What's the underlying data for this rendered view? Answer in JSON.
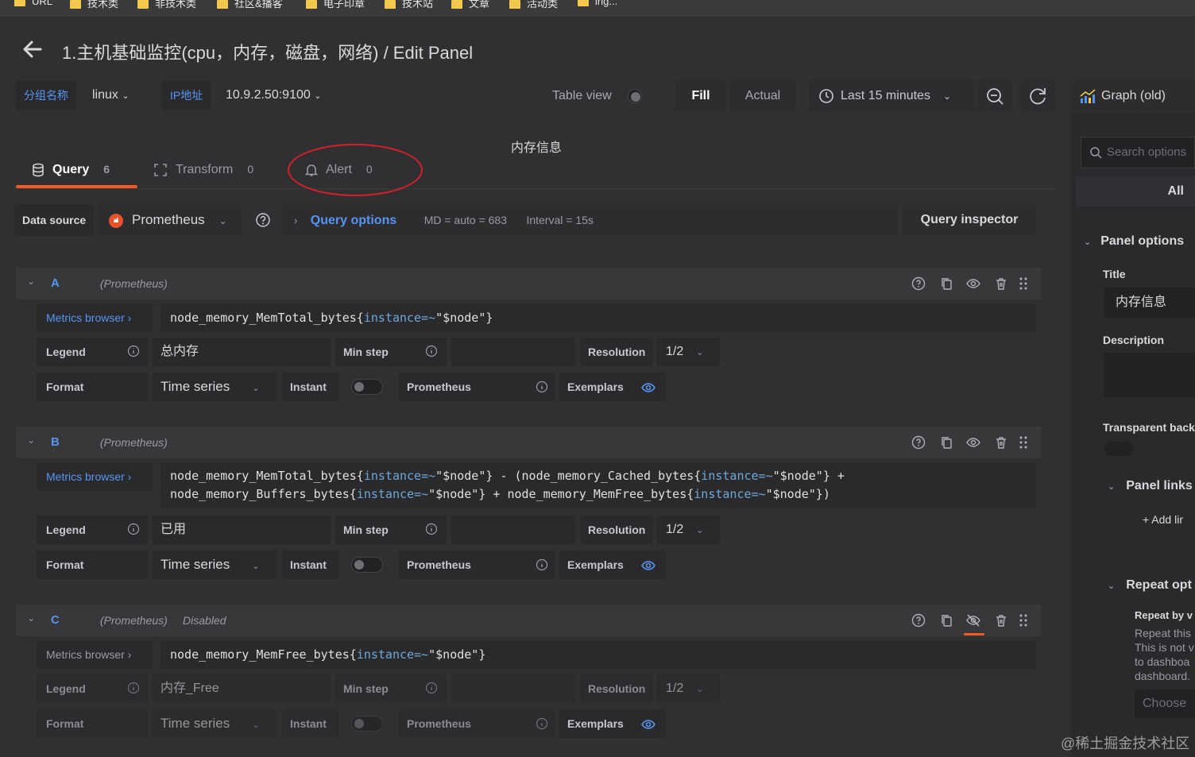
{
  "bookmarks": [
    {
      "label": "URL"
    },
    {
      "label": "技术类"
    },
    {
      "label": "非技术类"
    },
    {
      "label": "社区&播客"
    },
    {
      "label": "电子印章"
    },
    {
      "label": "技术站"
    },
    {
      "label": "文章"
    },
    {
      "label": "活动类"
    },
    {
      "label": "ing..."
    }
  ],
  "header": {
    "title": "1.主机基础监控(cpu，内存，磁盘，网络) / Edit Panel"
  },
  "variables": {
    "group_label": "分组名称",
    "group_value": "linux",
    "ip_label": "IP地址",
    "ip_value": "10.9.2.50:9100"
  },
  "toolbar": {
    "table_view": "Table view",
    "fill": "Fill",
    "actual": "Actual",
    "time_range": "Last 15 minutes",
    "viz": "Graph (old)"
  },
  "panel_preview_title": "内存信息",
  "tabs": [
    {
      "label": "Query",
      "count": "6"
    },
    {
      "label": "Transform",
      "count": "0"
    },
    {
      "label": "Alert",
      "count": "0"
    }
  ],
  "datasource": {
    "label": "Data source",
    "value": "Prometheus",
    "query_options": "Query options",
    "md": "MD = auto = 683",
    "interval": "Interval = 15s",
    "inspector": "Query inspector"
  },
  "labels": {
    "metrics_browser": "Metrics browser",
    "legend": "Legend",
    "min_step": "Min step",
    "resolution": "Resolution",
    "format": "Format",
    "instant": "Instant",
    "prometheus": "Prometheus",
    "exemplars": "Exemplars"
  },
  "queries": [
    {
      "ref": "A",
      "source": "(Prometheus)",
      "status": "",
      "expr_parts": [
        "node_memory_MemTotal_bytes{",
        "instance=~",
        "\"$node\"}"
      ],
      "legend": "总内存",
      "resolution": "1/2",
      "format": "Time series"
    },
    {
      "ref": "B",
      "source": "(Prometheus)",
      "status": "",
      "line1": [
        "node_memory_MemTotal_bytes{",
        "instance=~",
        "\"$node\"} - (node_memory_Cached_bytes{",
        "instance=~",
        "\"$node\"} +"
      ],
      "line2": [
        "node_memory_Buffers_bytes{",
        "instance=~",
        "\"$node\"} + node_memory_MemFree_bytes{",
        "instance=~",
        "\"$node\"})"
      ],
      "legend": "已用",
      "resolution": "1/2",
      "format": "Time series"
    },
    {
      "ref": "C",
      "source": "(Prometheus)",
      "status": "Disabled",
      "expr_parts": [
        "node_memory_MemFree_bytes{",
        "instance=~",
        "\"$node\"}"
      ],
      "legend": "内存_Free",
      "resolution": "1/2",
      "format": "Time series"
    }
  ],
  "options_pane": {
    "search_placeholder": "Search options",
    "all": "All",
    "panel_options": "Panel options",
    "title_label": "Title",
    "title_value": "内存信息",
    "description_label": "Description",
    "transparent_label": "Transparent back",
    "panel_links": "Panel links",
    "add_link": "+ Add lir",
    "repeat_options": "Repeat opt",
    "repeat_by": "Repeat by v",
    "repeat_help": [
      "Repeat this",
      "This is not v",
      "to dashboa",
      "dashboard."
    ],
    "choose": "Choose"
  },
  "watermark": "@稀土掘金技术社区",
  "colors": {
    "accent": "#5794f2",
    "annotation": "#d61f2a",
    "tab_active": "#f05a28"
  }
}
